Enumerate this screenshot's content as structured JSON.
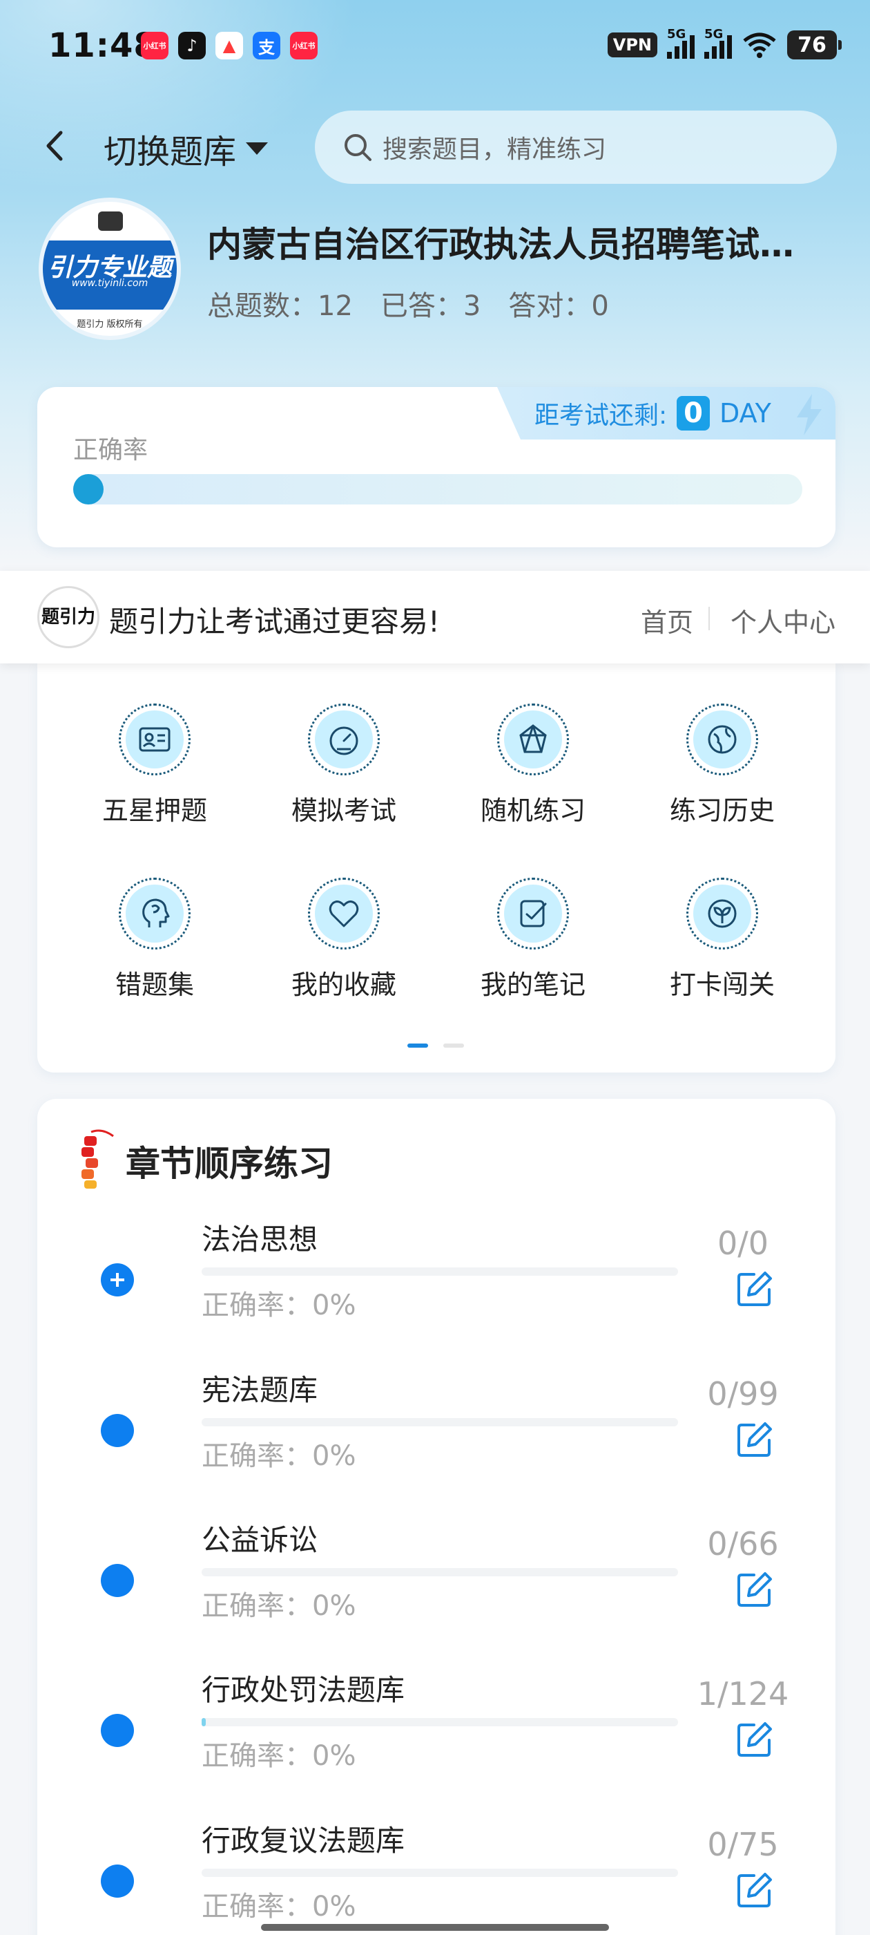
{
  "status_bar": {
    "time": "11:48",
    "apps": [
      {
        "name": "xiaohongshu-icon",
        "label": "小红书",
        "color": "#ff2442"
      },
      {
        "name": "douyin-icon",
        "label": "♪",
        "color": "#111111"
      },
      {
        "name": "app-triangle-icon",
        "label": "▲",
        "color": "#ff3b3b"
      },
      {
        "name": "alipay-icon",
        "label": "支",
        "color": "#1677ff"
      },
      {
        "name": "xiaohongshu-icon-2",
        "label": "小红书",
        "color": "#ff2442"
      }
    ],
    "vpn": "VPN",
    "net1": "5G",
    "net2": "5G",
    "battery": "76"
  },
  "header": {
    "switch_label": "切换题库",
    "search_placeholder": "搜索题目，精准练习"
  },
  "bank": {
    "logo_text": "引力专业题",
    "logo_url": "www.tiyinli.com",
    "logo_caption": "题引力 版权所有",
    "title": "内蒙古自治区行政执法人员招聘笔试…",
    "total": "总题数：12",
    "answered": "已答：3",
    "correct": "答对：0"
  },
  "accuracy": {
    "label": "正确率",
    "countdown_label": "距考试还剩:",
    "countdown_days": "0",
    "countdown_unit": "DAY",
    "value": 0
  },
  "banner": {
    "logo_text": "题引力",
    "slogan": "题引力让考试通过更容易!",
    "home": "首页",
    "user_center": "个人中心"
  },
  "features": [
    {
      "label": "五星押题",
      "icon": "id-card-icon"
    },
    {
      "label": "模拟考试",
      "icon": "gauge-icon"
    },
    {
      "label": "随机练习",
      "icon": "network-icon"
    },
    {
      "label": "练习历史",
      "icon": "globe-icon"
    },
    {
      "label": "错题集",
      "icon": "brain-icon"
    },
    {
      "label": "我的收藏",
      "icon": "heart-icon"
    },
    {
      "label": "我的笔记",
      "icon": "note-check-icon"
    },
    {
      "label": "打卡闯关",
      "icon": "sprout-icon"
    }
  ],
  "chapters_title": "章节顺序练习",
  "chapters": [
    {
      "name": "法治思想",
      "accuracy": "正确率：0%",
      "count": "0/0",
      "progress": 0,
      "expand": true
    },
    {
      "name": "宪法题库",
      "accuracy": "正确率：0%",
      "count": "0/99",
      "progress": 0,
      "expand": false
    },
    {
      "name": "公益诉讼",
      "accuracy": "正确率：0%",
      "count": "0/66",
      "progress": 0,
      "expand": false
    },
    {
      "name": "行政处罚法题库",
      "accuracy": "正确率：0%",
      "count": "1/124",
      "progress": 0.008,
      "expand": false
    },
    {
      "name": "行政复议法题库",
      "accuracy": "正确率：0%",
      "count": "0/75",
      "progress": 0,
      "expand": false
    }
  ]
}
